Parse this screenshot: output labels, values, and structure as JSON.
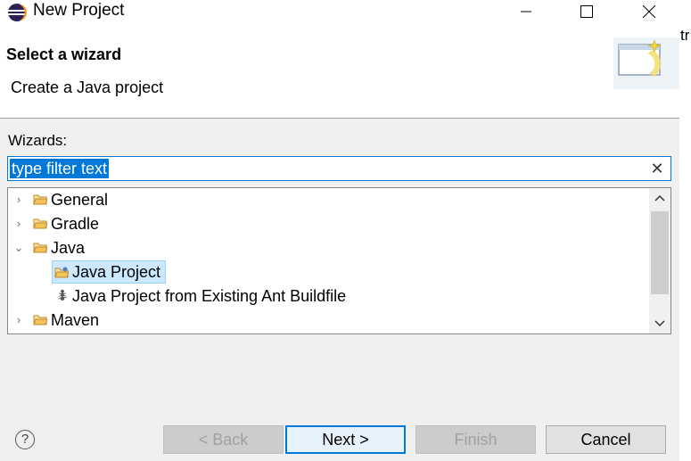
{
  "window": {
    "title": "New Project",
    "cutoff_text": "tr"
  },
  "header": {
    "title": "Select a wizard",
    "description": "Create a Java project"
  },
  "wizards": {
    "label": "Wizards:",
    "filter_placeholder": "type filter text",
    "filter_value": "type filter text"
  },
  "tree": {
    "items": [
      {
        "label": "General",
        "expanded": false,
        "level": 0
      },
      {
        "label": "Gradle",
        "expanded": false,
        "level": 0
      },
      {
        "label": "Java",
        "expanded": true,
        "level": 0
      },
      {
        "label": "Java Project",
        "level": 1,
        "selected": true
      },
      {
        "label": "Java Project from Existing Ant Buildfile",
        "level": 1
      },
      {
        "label": "Maven",
        "expanded": false,
        "level": 0
      }
    ]
  },
  "buttons": {
    "help": "?",
    "back": "< Back",
    "next": "Next >",
    "finish": "Finish",
    "cancel": "Cancel"
  },
  "colors": {
    "accent": "#0078d7",
    "selection": "#cce8ff",
    "folder": "#d9a440"
  }
}
